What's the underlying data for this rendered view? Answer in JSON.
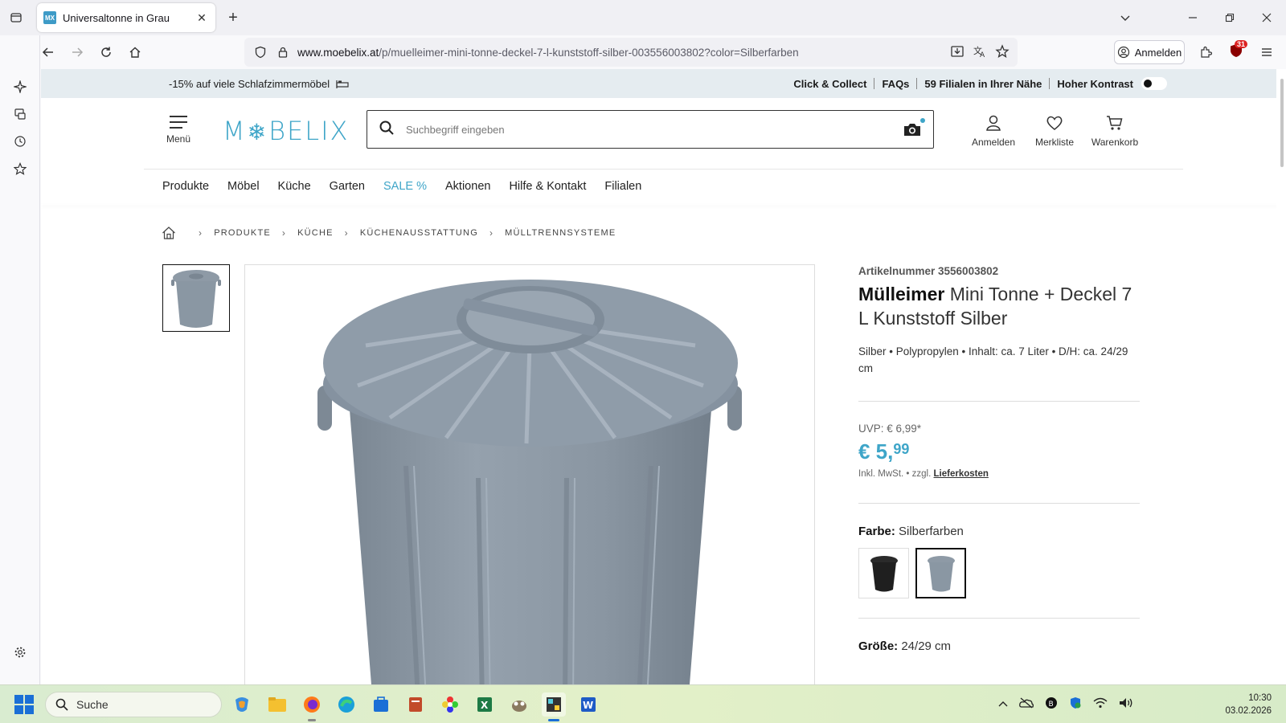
{
  "browser": {
    "tab_title": "Universaltonne in Grau",
    "tab_favicon_text": "MX",
    "url_domain": "www.moebelix.at",
    "url_path": "/p/muelleimer-mini-tonne-deckel-7-l-kunststoff-silber-003556003802?color=Silberfarben",
    "signin_label": "Anmelden",
    "extension_badge": "31"
  },
  "promo": {
    "left_text": "-15% auf viele Schlafzimmermöbel",
    "links": [
      "Click & Collect",
      "FAQs",
      "59 Filialen in Ihrer Nähe",
      "Hoher Kontrast"
    ]
  },
  "header": {
    "menu_label": "Menü",
    "logo_left": "M",
    "logo_right": "BELIX",
    "search_placeholder": "Suchbegriff eingeben",
    "account_label": "Anmelden",
    "wishlist_label": "Merkliste",
    "cart_label": "Warenkorb"
  },
  "nav": {
    "items": [
      "Produkte",
      "Möbel",
      "Küche",
      "Garten",
      "SALE %",
      "Aktionen",
      "Hilfe & Kontakt",
      "Filialen"
    ]
  },
  "breadcrumb": [
    "PRODUKTE",
    "KÜCHE",
    "KÜCHENAUSSTATTUNG",
    "MÜLLTRENNSYSTEME"
  ],
  "product": {
    "article_number": "Artikelnummer 3556003802",
    "title_bold": "Mülleimer",
    "title_rest": " Mini Tonne + Deckel 7 L Kunststoff Silber",
    "attributes": "Silber • Polypropylen • Inhalt: ca. 7 Liter • D/H: ca. 24/29 cm",
    "uvp": "UVP: € 6,99*",
    "price_main": "€ 5,",
    "price_cents": "99",
    "note_prefix": "Inkl. MwSt. • zzgl.",
    "note_link": "Lieferkosten",
    "color_label": "Farbe:",
    "color_value": " Silberfarben",
    "size_label": "Größe:",
    "size_value": " 24/29 cm"
  },
  "taskbar": {
    "search_label": "Suche",
    "time": "10:30",
    "date": "03.02.2026"
  },
  "colors": {
    "brand": "#3ea5c8",
    "product_grey": "#8a97a3"
  }
}
